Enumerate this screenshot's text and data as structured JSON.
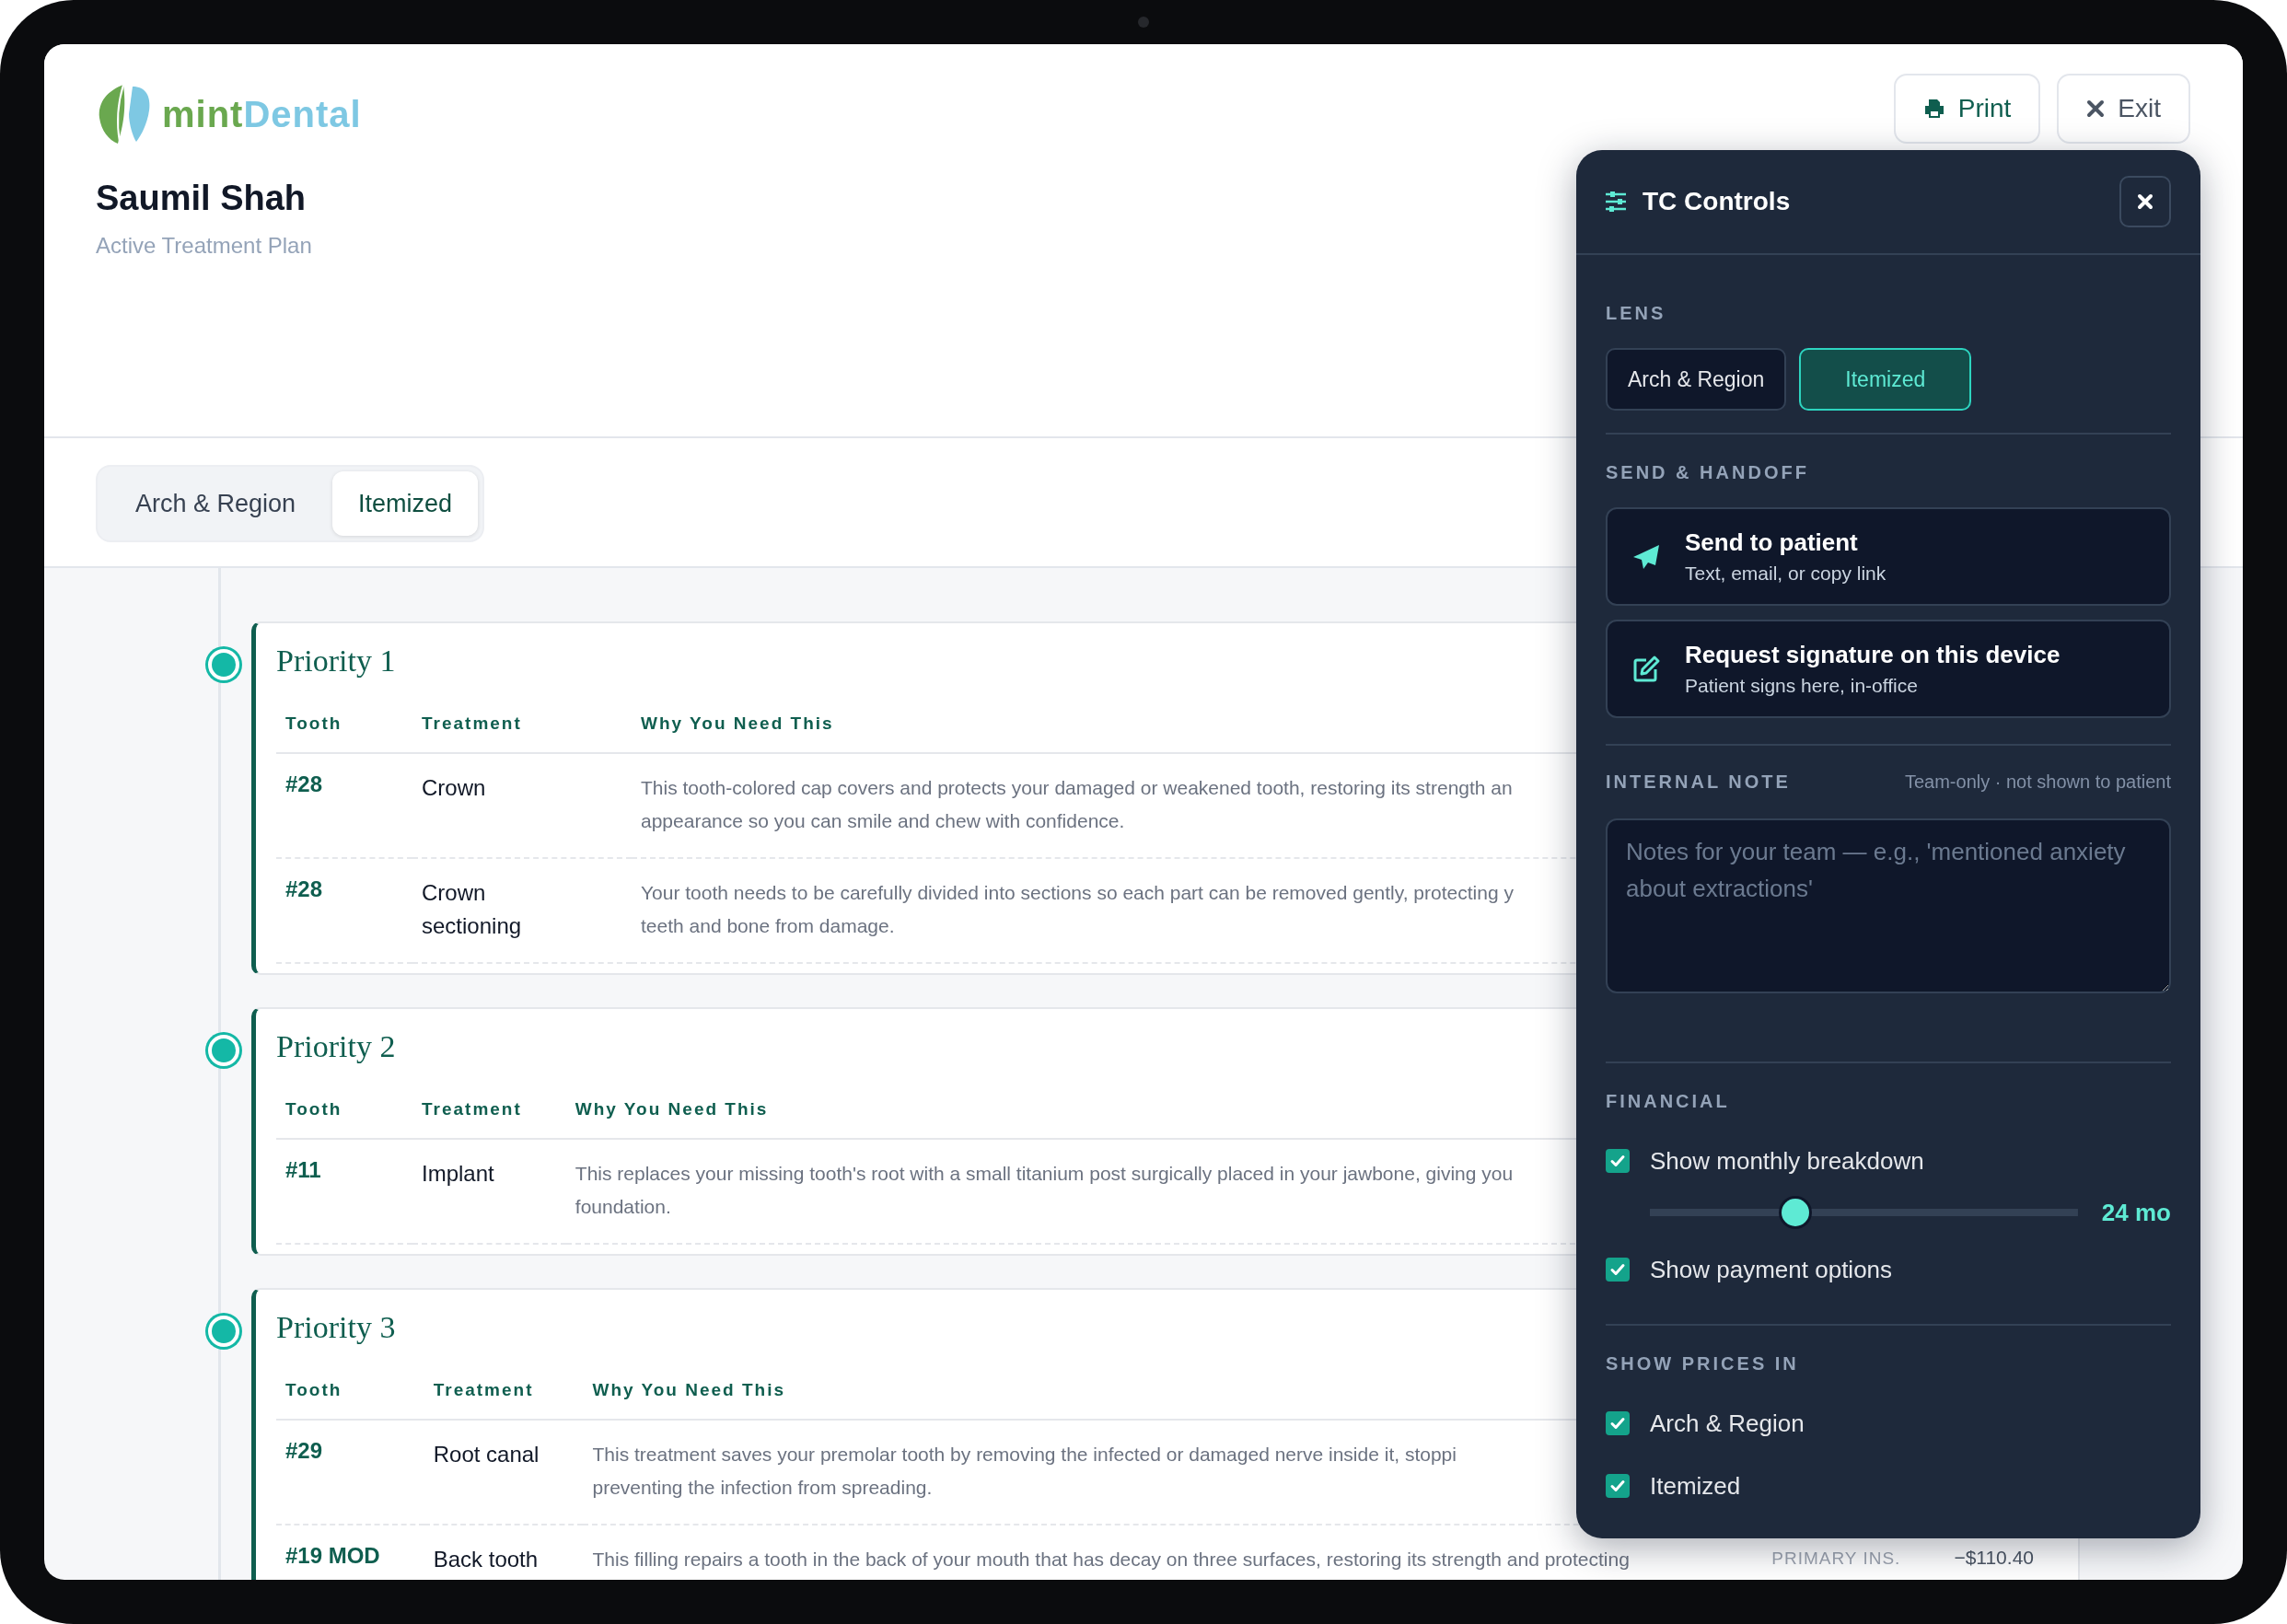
{
  "logo": {
    "prefix": "mint",
    "suffix": "Dental"
  },
  "patient": {
    "name": "Saumil Shah",
    "subtitle": "Active Treatment Plan"
  },
  "header_buttons": [
    {
      "kind": "print",
      "label": "Print"
    },
    {
      "kind": "exit",
      "label": "Exit"
    }
  ],
  "view_tabs": [
    {
      "label": "Arch & Region",
      "selected": false
    },
    {
      "label": "Itemized",
      "selected": true
    }
  ],
  "priorities": [
    {
      "title": "Priority 1",
      "columns": [
        "Tooth",
        "Treatment",
        "Why You Need This"
      ],
      "rows": [
        {
          "tooth": "#28",
          "treatment": "Crown",
          "why": [
            "This tooth-colored cap covers and protects your damaged or weakened tooth, restoring its strength an",
            "appearance so you can smile and chew with confidence."
          ]
        },
        {
          "tooth": "#28",
          "treatment": "Crown sectioning",
          "why": [
            "Your tooth needs to be carefully divided into sections so each part can be removed gently, protecting y",
            "teeth and bone from damage."
          ]
        }
      ]
    },
    {
      "title": "Priority 2",
      "columns": [
        "Tooth",
        "Treatment",
        "Why You Need This"
      ],
      "rows": [
        {
          "tooth": "#11",
          "treatment": "Implant",
          "why": [
            "This replaces your missing tooth's root with a small titanium post surgically placed in your jawbone, giving you",
            "foundation."
          ]
        }
      ]
    },
    {
      "title": "Priority 3",
      "columns": [
        "Tooth",
        "Treatment",
        "Why You Need This"
      ],
      "rows": [
        {
          "tooth": "#29",
          "treatment": "Root canal",
          "why": [
            "This treatment saves your premolar tooth by removing the infected or damaged nerve inside it, stoppi",
            "preventing the infection from spreading."
          ]
        },
        {
          "tooth": "#19 MOD",
          "treatment": "Back tooth",
          "why": [
            "This filling repairs a tooth in the back of your mouth that has decay on three surfaces, restoring its strength and protecting"
          ],
          "price_label": "PRIMARY INS.",
          "price": "−$110.40"
        }
      ]
    }
  ],
  "panel": {
    "title": "TC Controls",
    "lens": {
      "label": "LENS",
      "options": [
        {
          "label": "Arch & Region",
          "selected": false
        },
        {
          "label": "Itemized",
          "selected": true
        }
      ]
    },
    "send": {
      "label": "SEND & HANDOFF",
      "actions": [
        {
          "kind": "send",
          "title": "Send to patient",
          "subtitle": "Text, email, or copy link"
        },
        {
          "kind": "sign",
          "title": "Request signature on this device",
          "subtitle": "Patient signs here, in-office"
        }
      ]
    },
    "note": {
      "label": "INTERNAL NOTE",
      "hint": "Team-only · not shown to patient",
      "placeholder": "Notes for your team — e.g., 'mentioned anxiety about extractions'"
    },
    "financial": {
      "label": "FINANCIAL",
      "items": [
        {
          "kind": "checkbox",
          "label": "Show monthly breakdown",
          "checked": true
        },
        {
          "kind": "slider",
          "level": 0.34,
          "reading": "24 mo"
        },
        {
          "kind": "checkbox",
          "label": "Show payment options",
          "checked": true
        }
      ]
    },
    "prices_in": {
      "label": "SHOW PRICES IN",
      "options": [
        {
          "label": "Arch & Region",
          "checked": true
        },
        {
          "label": "Itemized",
          "checked": true
        }
      ]
    }
  }
}
